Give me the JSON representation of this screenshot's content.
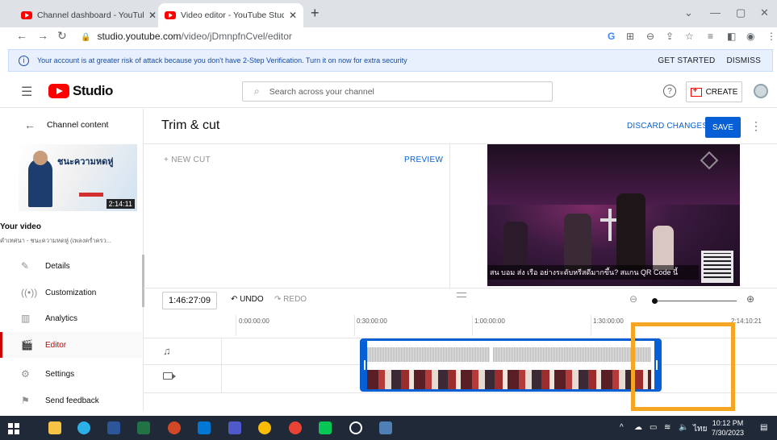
{
  "browser": {
    "tabs": [
      {
        "title": "Channel dashboard - YouTube St",
        "active": false
      },
      {
        "title": "Video editor - YouTube Studio",
        "active": true
      }
    ],
    "url_host": "studio.youtube.com",
    "url_path": "/video/jDmnpfnCvel/editor"
  },
  "banner": {
    "message": "Your account is at greater risk of attack because you don't have 2-Step Verification. Turn it on now for extra security",
    "get_started": "GET STARTED",
    "dismiss": "DISMISS"
  },
  "header": {
    "logo_text": "Studio",
    "search_placeholder": "Search across your channel",
    "help": "?",
    "create_label": "CREATE"
  },
  "sidebar": {
    "back_label": "Channel content",
    "thumb_title": "ชนะความหดหู่",
    "thumb_duration": "2:14:11",
    "your_video_label": "Your video",
    "video_title": "คำเทศนา - ชนะความหดหู่ (เพลงคร่ำครว...",
    "items": [
      {
        "label": "Details",
        "icon": "pencil-icon",
        "active": false
      },
      {
        "label": "Customization",
        "icon": "broadcast-icon",
        "active": false
      },
      {
        "label": "Analytics",
        "icon": "analytics-icon",
        "active": false
      },
      {
        "label": "Editor",
        "icon": "clapper-icon",
        "active": true
      },
      {
        "label": "Settings",
        "icon": "gear-icon",
        "active": false
      },
      {
        "label": "Send feedback",
        "icon": "feedback-icon",
        "active": false
      }
    ]
  },
  "main": {
    "title": "Trim & cut",
    "discard_label": "DISCARD CHANGES",
    "save_label": "SAVE",
    "new_cut_label": "+  NEW CUT",
    "preview_label": "PREVIEW",
    "video_caption": "สน บอม ส่ง เรือ อย่างระดับหรีสดีมากขึ้น? สแกน QR Code นี้"
  },
  "toolbar": {
    "timecode": "1:46:27:09",
    "undo_label": "UNDO",
    "redo_label": "REDO",
    "zoom_level": 0.03
  },
  "timeline": {
    "ruler_labels": [
      "0:00:00:00",
      "0:30:00:00",
      "1:00:00:00",
      "1:30:00:00",
      "2:14:10:21"
    ]
  },
  "taskbar": {
    "time": "10:12 PM",
    "date": "7/30/2023",
    "lang": "ไทย"
  },
  "colors": {
    "accent": "#065fd4",
    "brand_red": "#ff0000",
    "highlight": "#f5a623"
  }
}
